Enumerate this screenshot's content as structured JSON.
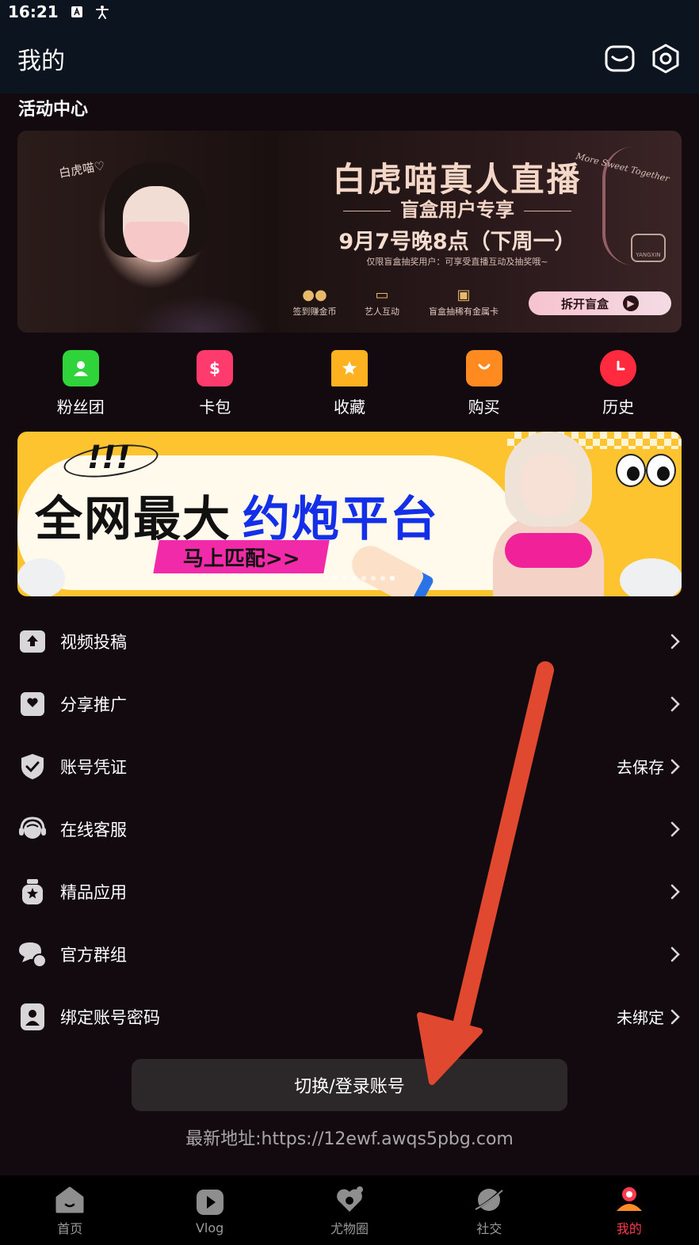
{
  "status_bar": {
    "time": "16:21"
  },
  "header": {
    "title": "我的"
  },
  "section": {
    "title": "活动中心"
  },
  "banner_live": {
    "signature": "白虎喵♡",
    "title": "白虎喵真人直播",
    "subtitle": "盲盒用户专享",
    "date": "9月7号晚8点（下周一）",
    "note": "仅限盲盒抽奖用户：可享受直播互动及抽奖哦~",
    "features": [
      "签到赚金币",
      "艺人互动",
      "盲盒抽稀有金属卡"
    ],
    "cta": "拆开盲盒",
    "script": "More Sweet Together",
    "logo": "YANGXIN"
  },
  "quick_actions": [
    {
      "label": "粉丝团",
      "color": "#2fd43a"
    },
    {
      "label": "卡包",
      "color": "#ff3b6e"
    },
    {
      "label": "收藏",
      "color": "#ffb21f"
    },
    {
      "label": "购买",
      "color": "#ff8a1f"
    },
    {
      "label": "历史",
      "color": "#ff2a3d"
    }
  ],
  "banner_promo": {
    "exclaim": "!!!",
    "headline_black": "全网最大",
    "headline_blue": "约炮平台",
    "cta": "马上匹配>>"
  },
  "menu": [
    {
      "label": "视频投稿",
      "value": ""
    },
    {
      "label": "分享推广",
      "value": ""
    },
    {
      "label": "账号凭证",
      "value": "去保存"
    },
    {
      "label": "在线客服",
      "value": ""
    },
    {
      "label": "精品应用",
      "value": ""
    },
    {
      "label": "官方群组",
      "value": ""
    },
    {
      "label": "绑定账号密码",
      "value": "未绑定"
    }
  ],
  "switch_button": {
    "label": "切换/登录账号"
  },
  "latest_url": "最新地址:https://12ewf.awqs5pbg.com",
  "tabs": [
    {
      "label": "首页",
      "active": false
    },
    {
      "label": "Vlog",
      "active": false
    },
    {
      "label": "尤物圈",
      "active": false
    },
    {
      "label": "社交",
      "active": false
    },
    {
      "label": "我的",
      "active": true
    }
  ],
  "colors": {
    "background": "#120a0e",
    "header": "#0c1420",
    "accent": "#ff3b4f",
    "arrow": "#e0492f"
  }
}
